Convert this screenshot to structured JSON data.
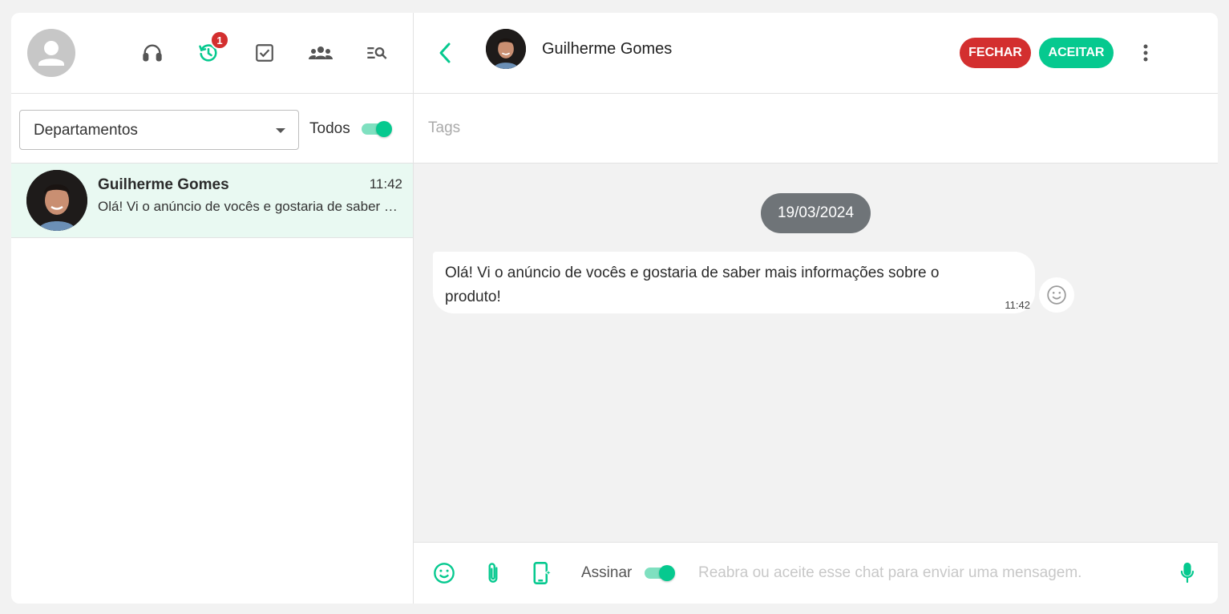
{
  "colors": {
    "accent": "#06c98f",
    "danger": "#d32f2f",
    "pill": "#6f7478"
  },
  "left": {
    "toolbar": {
      "icons": [
        "headset-icon",
        "history-icon",
        "checkbox-icon",
        "groups-icon",
        "search-list-icon"
      ],
      "history_badge": "1"
    },
    "filter": {
      "department_label": "Departamentos",
      "todos_label": "Todos",
      "todos_on": true
    },
    "chats": [
      {
        "name": "Guilherme Gomes",
        "time": "11:42",
        "preview": "Olá! Vi o anúncio de vocês e gostaria de saber mais informações sobre o produto!"
      }
    ]
  },
  "right": {
    "header": {
      "contact_name": "Guilherme Gomes",
      "close_label": "FECHAR",
      "accept_label": "ACEITAR"
    },
    "tags_placeholder": "Tags",
    "messages": {
      "date": "19/03/2024",
      "items": [
        {
          "text": "Olá! Vi o anúncio de vocês e gostaria de saber mais informações sobre o produto!",
          "time": "11:42"
        }
      ]
    },
    "composer": {
      "sign_label": "Assinar",
      "sign_on": true,
      "placeholder": "Reabra ou aceite esse chat para enviar uma mensagem."
    }
  }
}
